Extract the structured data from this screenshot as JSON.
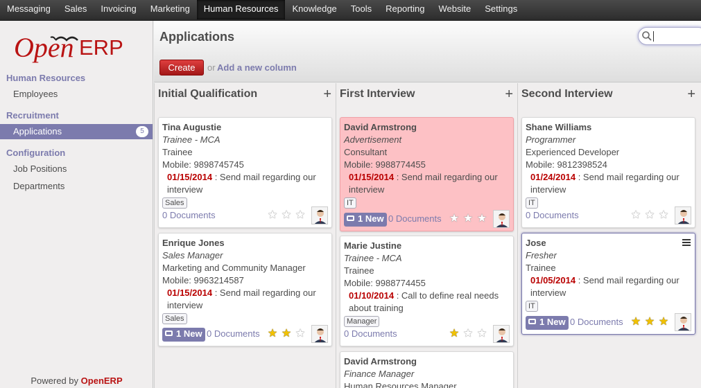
{
  "topmenu": [
    "Messaging",
    "Sales",
    "Invoicing",
    "Marketing",
    "Human Resources",
    "Knowledge",
    "Tools",
    "Reporting",
    "Website",
    "Settings"
  ],
  "topmenu_active": "Human Resources",
  "logo": {
    "text_open": "Open",
    "text_erp": "ERP"
  },
  "sidebar": {
    "hr_section": "Human Resources",
    "employees": "Employees",
    "recruitment_section": "Recruitment",
    "applications": "Applications",
    "applications_count": "5",
    "configuration_section": "Configuration",
    "job_positions": "Job Positions",
    "departments": "Departments",
    "powered_by": "Powered by",
    "powered_brand": "OpenERP"
  },
  "header": {
    "title": "Applications",
    "create_label": "Create",
    "or_label": "or",
    "add_column_label": "Add a new column",
    "search_value": ""
  },
  "columns": [
    {
      "title": "Initial Qualification",
      "add_icon": "+",
      "cards": [
        {
          "name": "Tina Augustie",
          "source": "Trainee - MCA",
          "job": "Trainee",
          "mobile": "Mobile: 9898745745",
          "date": "01/15/2014",
          "activity": " : Send mail regarding our interview",
          "tag": "Sales",
          "new": "",
          "docs": "0 Documents",
          "stars": 0
        },
        {
          "name": "Enrique Jones",
          "source": "Sales Manager",
          "job": "Marketing and Community Manager",
          "mobile": "Mobile: 9963214587",
          "date": "01/15/2014",
          "activity": " : Send mail regarding our interview",
          "tag": "Sales",
          "new": "1 New",
          "docs": "0 Documents",
          "stars": 2
        }
      ]
    },
    {
      "title": "First Interview",
      "add_icon": "+",
      "cards": [
        {
          "name": "David Armstrong",
          "source": "Advertisement",
          "job": "Consultant",
          "mobile": "Mobile: 9988774455",
          "date": "01/15/2014",
          "activity": " : Send mail regarding our interview",
          "tag": "IT",
          "new": "1 New",
          "docs": "0 Documents",
          "stars": 0,
          "color": "#fdc1c5"
        },
        {
          "name": "Marie Justine",
          "source": "Trainee - MCA",
          "job": "Trainee",
          "mobile": "Mobile: 9988774455",
          "date": "01/10/2014",
          "activity": " : Call to define real needs about training",
          "tag": "Manager",
          "new": "",
          "docs": "0 Documents",
          "stars": 1
        },
        {
          "name": "David Armstrong",
          "source": "Finance Manager",
          "job": "Human Resources Manager"
        }
      ]
    },
    {
      "title": "Second Interview",
      "add_icon": "+",
      "cards": [
        {
          "name": "Shane Williams",
          "source": "Programmer",
          "job": "Experienced Developer",
          "mobile": "Mobile: 9812398524",
          "date": "01/24/2014",
          "activity": " : Send mail regarding our interview",
          "tag": "IT",
          "new": "",
          "docs": "0 Documents",
          "stars": 0
        },
        {
          "name": "Jose",
          "source": "Fresher",
          "job": "Trainee",
          "date": "01/05/2014",
          "activity": " : Send mail regarding our interview",
          "tag": "IT",
          "new": "1 New",
          "docs": "0 Documents",
          "stars": 3
        }
      ]
    }
  ],
  "icons": {
    "search": "search-icon",
    "star": "star-icon",
    "avatar": "user-avatar",
    "menu": "menu-icon",
    "new": "message-bubble-icon"
  },
  "colors": {
    "brand": "#7c7bad",
    "create": "#c22b2b",
    "overdue_date": "#b90000",
    "red_card": "#fdc1c5",
    "star_on": "#f2c200"
  }
}
